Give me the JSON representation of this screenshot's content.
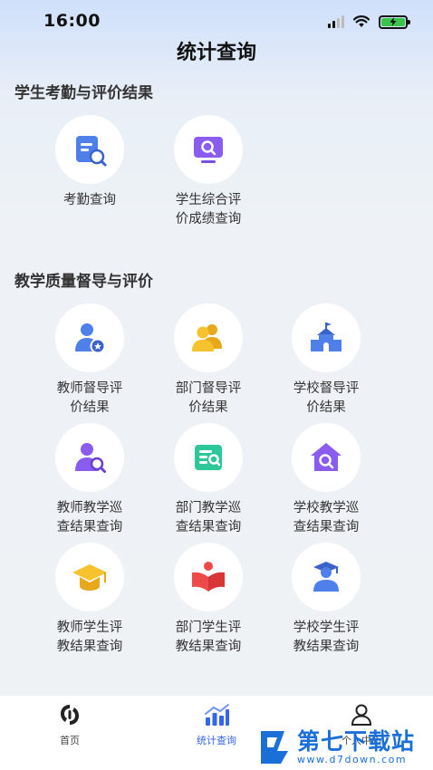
{
  "status_bar": {
    "time": "16:00"
  },
  "page_title": "统计查询",
  "sections": [
    {
      "title": "学生考勤与评价结果",
      "items": [
        {
          "label_lines": [
            "考勤查询"
          ],
          "icon": "clipboard-search-icon"
        },
        {
          "label_lines": [
            "学生综合评",
            "价成绩查询"
          ],
          "icon": "monitor-search-icon"
        }
      ]
    },
    {
      "title": "教学质量督导与评价",
      "items": [
        {
          "label_lines": [
            "教师督导评",
            "价结果"
          ],
          "icon": "teacher-badge-icon"
        },
        {
          "label_lines": [
            "部门督导评",
            "价结果"
          ],
          "icon": "department-people-icon"
        },
        {
          "label_lines": [
            "学校督导评",
            "价结果"
          ],
          "icon": "school-building-icon"
        },
        {
          "label_lines": [
            "教师教学巡",
            "查结果查询"
          ],
          "icon": "teacher-search-icon"
        },
        {
          "label_lines": [
            "部门教学巡",
            "查结果查询"
          ],
          "icon": "document-search-icon"
        },
        {
          "label_lines": [
            "学校教学巡",
            "查结果查询"
          ],
          "icon": "house-search-icon"
        },
        {
          "label_lines": [
            "教师学生评",
            "教结果查询"
          ],
          "icon": "graduation-cap-icon"
        },
        {
          "label_lines": [
            "部门学生评",
            "教结果查询"
          ],
          "icon": "open-book-icon"
        },
        {
          "label_lines": [
            "学校学生评",
            "教结果查询"
          ],
          "icon": "student-graduate-icon"
        }
      ]
    }
  ],
  "tab_bar": [
    {
      "label": "首页",
      "icon": "home-logo-icon",
      "active": false
    },
    {
      "label": "统计查询",
      "icon": "bar-chart-icon",
      "active": true
    },
    {
      "label": "个人中心",
      "icon": "person-icon",
      "active": false
    }
  ],
  "watermark": {
    "text_cn": "第七下载站",
    "text_url": "www.d7down.com"
  },
  "colors": {
    "accent": "#3566e8",
    "tab_inactive": "#444444",
    "watermark_blue": "#1b6fd8"
  }
}
